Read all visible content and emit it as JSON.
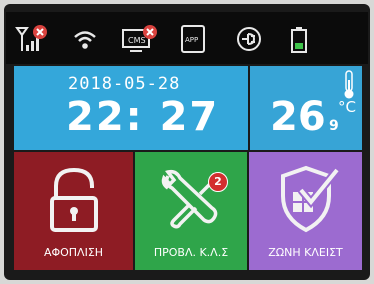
{
  "status_icons": [
    {
      "icon": "signal-no-sim-icon"
    },
    {
      "icon": "wifi-icon"
    },
    {
      "icon": "cms-disconnected-icon",
      "label": "CMS"
    },
    {
      "icon": "app-icon",
      "label": "APP"
    },
    {
      "icon": "ac-power-plug-icon"
    },
    {
      "icon": "battery-icon"
    }
  ],
  "clock": {
    "date": "2018-05-28",
    "time": "22: 27"
  },
  "temperature": {
    "integer": "26",
    "decimal": "9",
    "unit": "°C"
  },
  "tiles": [
    {
      "label": "ΑΦΟΠΛΙΣΗ",
      "icon": "padlock-icon"
    },
    {
      "label": "ΠΡΟΒΛ. Κ.Λ.Σ",
      "icon": "tools-icon",
      "badge": "2"
    },
    {
      "label": "ΖΩΝΗ ΚΛΕΙΣΤ",
      "icon": "shield-check-icon"
    }
  ],
  "colors": {
    "blue": "#34a7da",
    "red": "#8e1c24",
    "green": "#2fa54a",
    "purple": "#9c6bd0",
    "alert": "#d32f2f"
  }
}
